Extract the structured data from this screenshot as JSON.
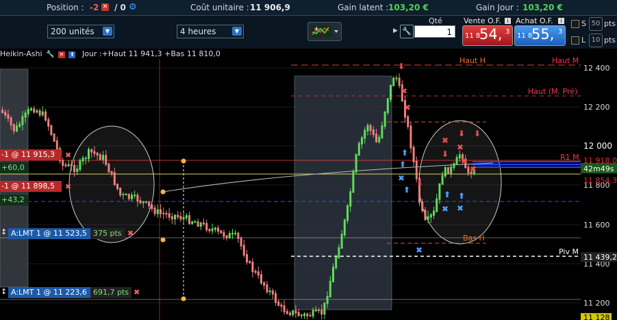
{
  "topbar": {
    "position_label": "Position :",
    "position_value": "-2",
    "position_sep": "/ 0",
    "cost_label": "Coût unitaire :",
    "cost_value": "11 906,9",
    "latent_label": "Gain latent :",
    "latent_value": "103,20 €",
    "day_label": "Gain Jour :",
    "day_value": "103,20 €"
  },
  "toolbar": {
    "units_select": "200 unités",
    "period_select": "4 heures",
    "qty_label": "Qté",
    "qty_value": "1",
    "sell_label": "Vente O.F.",
    "sell_small": "11 8",
    "sell_big": "54,",
    "sell_sup": "3",
    "buy_label": "Achat O.F.",
    "buy_small": "11 8",
    "buy_big": "55,",
    "buy_sup": "3",
    "s_label": "S",
    "s_pts": "50",
    "l_label": "L",
    "l_pts": "10",
    "pts": "pts"
  },
  "chart": {
    "type_label": "Heikin-Ashi",
    "info": "Jour :+Haut 11 941,3 +Bas 11 810,0",
    "orders": [
      {
        "label": "-1 @ 11 915,3",
        "gain": "+60,0"
      },
      {
        "label": "-1 @ 11 898,5",
        "gain": "+43,2"
      }
    ],
    "limits": [
      {
        "label": "A:LMT 1 @ 11 523,5",
        "pts": "375 pts"
      },
      {
        "label": "A:LMT 1 @ 11 223,6",
        "pts": "691,7 pts"
      }
    ],
    "levels": {
      "haut_h": "Haut H",
      "haut_m": "Haut M",
      "haut_m_pre": "Haut (M. Pré)",
      "r1_m": "R1 M",
      "bas_h": "Bas H",
      "piv_m": "Piv M"
    },
    "price_axis": [
      "12 400",
      "12 200",
      "12 000",
      "11 800",
      "11 600",
      "11 400",
      "11 200"
    ],
    "r1_price": "11 918,0",
    "timer": "42m49s",
    "last_price": "11 854,3",
    "piv_price": "11 439,2",
    "bottom_price": "11 128"
  },
  "colors": {
    "up": "#5fdc5a",
    "down": "#f08080",
    "order_red": "#c83232",
    "limit_blue": "#1c5aa8",
    "gain_green": "#7fe07f"
  }
}
